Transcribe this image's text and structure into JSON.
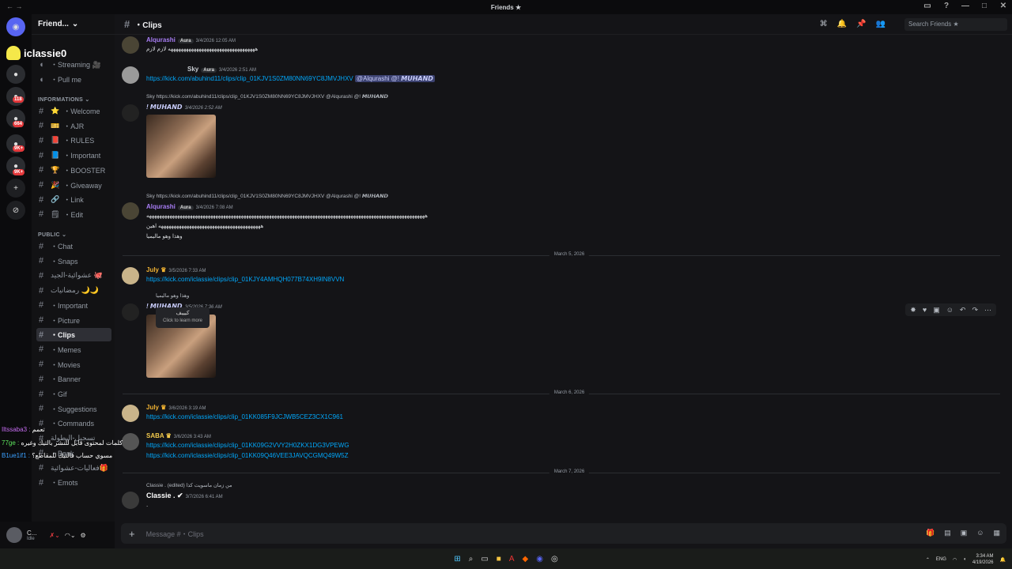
{
  "window": {
    "title": "Friends ★"
  },
  "sidebar": {
    "server_name": "Friend...",
    "cat_info": "INFORMATIONS",
    "cat_public": "PUBLIC",
    "top_items": [
      {
        "label": "・Streaming 🎥"
      },
      {
        "label": "・Pull me"
      }
    ],
    "info_items": [
      {
        "label": "・Welcome",
        "emoji": "⭐"
      },
      {
        "label": "・AJR",
        "emoji": "🎫"
      },
      {
        "label": "・RULES",
        "emoji": "📕"
      },
      {
        "label": "・Important",
        "emoji": "📘"
      },
      {
        "label": "・BOOSTER",
        "emoji": "🏆"
      },
      {
        "label": "・Giveaway",
        "emoji": "🎉"
      },
      {
        "label": "・Link",
        "emoji": "🔗"
      },
      {
        "label": "・Edit",
        "emoji": "🗒"
      }
    ],
    "public_items": [
      {
        "label": "・Chat"
      },
      {
        "label": "・Snaps"
      },
      {
        "label": "عشوائية-الجيد 🐙"
      },
      {
        "label": "رمضانيات 🌙🌙"
      },
      {
        "label": "・Important"
      },
      {
        "label": "・Picture"
      },
      {
        "label": "・Clips"
      },
      {
        "label": "・Memes"
      },
      {
        "label": "・Movies"
      },
      {
        "label": "・Banner"
      },
      {
        "label": "・Gif"
      },
      {
        "label": "・Suggestions"
      },
      {
        "label": "・Commands"
      },
      {
        "label": "تسجيل-البطولة"
      },
      {
        "label": "・Bank"
      },
      {
        "label": "فعاليات-عشوائية🎁"
      },
      {
        "label": "・Emots"
      }
    ],
    "user": {
      "name": "C...",
      "status": "Idle"
    }
  },
  "header": {
    "channel": "・Clips",
    "search_placeholder": "Search Friends ★"
  },
  "messages": [
    {
      "user": "Alqurashi",
      "tag": "Aura",
      "time": "3/4/2026 12:05 AM",
      "text": "ههههههههههههههههههههههههههههههههههه لازم لازم"
    },
    {
      "user": "Sky",
      "tag": "Aura",
      "time": "3/4/2026 2:51 AM",
      "link": "https://kick.com/abuhind11/clips/clip_01KJV1S0ZM80NN69YC8JMVJHXV",
      "mentions": "@Alqurashi @! 𝙈𝙐𝙃𝘼𝙉𝘿"
    },
    {
      "user": "! 𝙈𝙐𝙃𝘼𝙉𝘿",
      "time": "3/4/2026 2:52 AM",
      "reply": "Sky  https://kick.com/abuhind11/clips/clip_01KJV1S0ZM80NN69YC8JMVJHXV @Alqurashi @! 𝙈𝙐𝙃𝘼𝙉𝘿"
    },
    {
      "user": "Alqurashi",
      "tag": "Aura",
      "time": "3/4/2026 7:08 AM",
      "reply": "Sky  https://kick.com/abuhind11/clips/clip_01KJV1S0ZM80NN69YC8JMVJHXV @Alqurashi @! 𝙈𝙐𝙃𝘼𝙉𝘿",
      "text": "هههههههههههههههههههههههههههههههههههههههههههههههههههههههههههههههههههههههههههههههههههههههههههههههههههههههههههههه",
      "text2": "ههههههههههههههههههههههههههههههههههههههههه اهين",
      "text3": "وهذا وهو ماليميا"
    },
    {
      "divider": "March 5, 2026"
    },
    {
      "user": "July",
      "time": "3/5/2026 7:33 AM",
      "link": "https://kick.com/iclassie/clips/clip_01KJY4AMHQH077B74XH9IN8VVN"
    },
    {
      "user": "! 𝙈𝙐𝙃𝘼𝙉𝘿",
      "time": "3/5/2026 7:36 AM",
      "reply": "وهذا وهو ماليميا"
    },
    {
      "divider": "March 6, 2026"
    },
    {
      "user": "July",
      "time": "3/6/2026 3:19 AM",
      "link": "https://kick.com/iclassie/clips/clip_01KK085F9JCJWB5CEZ3CX1C961"
    },
    {
      "user": "SABA",
      "time": "3/6/2026 3:43 AM",
      "link": "https://kick.com/iclassie/clips/clip_01KK09G2VVY2H0ZKX1DG3VPEWG",
      "link2": "https://kick.com/iclassie/clips/clip_01KK09Q46VEE3JAVQCGMQ49W5Z"
    },
    {
      "divider": "March 7, 2026"
    },
    {
      "user": "Classie .",
      "time": "3/7/2026 6:41 AM",
      "reply": "Classie .  (edited)  من زمان ماسويت كذا",
      "text": "."
    }
  ],
  "tooltip": {
    "title": "كيييف",
    "sub": "Click to learn more"
  },
  "composer": {
    "placeholder": "Message #・Clips"
  },
  "overlay": {
    "streamer": "iclassie0",
    "chat": [
      {
        "user": "Iltssaba3 :",
        "text": "تعمم"
      },
      {
        "user": "77ge :",
        "text": "كلمات لمحتوى قابل للنشر بالتيك وغيره"
      },
      {
        "user": "B1ue1if1 :",
        "text": "مسوي حساب فالتيك للمقاطع؟"
      }
    ]
  },
  "taskbar": {
    "lang": "ENG",
    "time": "3:34 AM",
    "date": "4/19/2026"
  },
  "colors": {
    "accent": "#00a8fc",
    "alqurashi": "#a67cf2",
    "july": "#f0b232",
    "saba": "#f2c94c"
  }
}
